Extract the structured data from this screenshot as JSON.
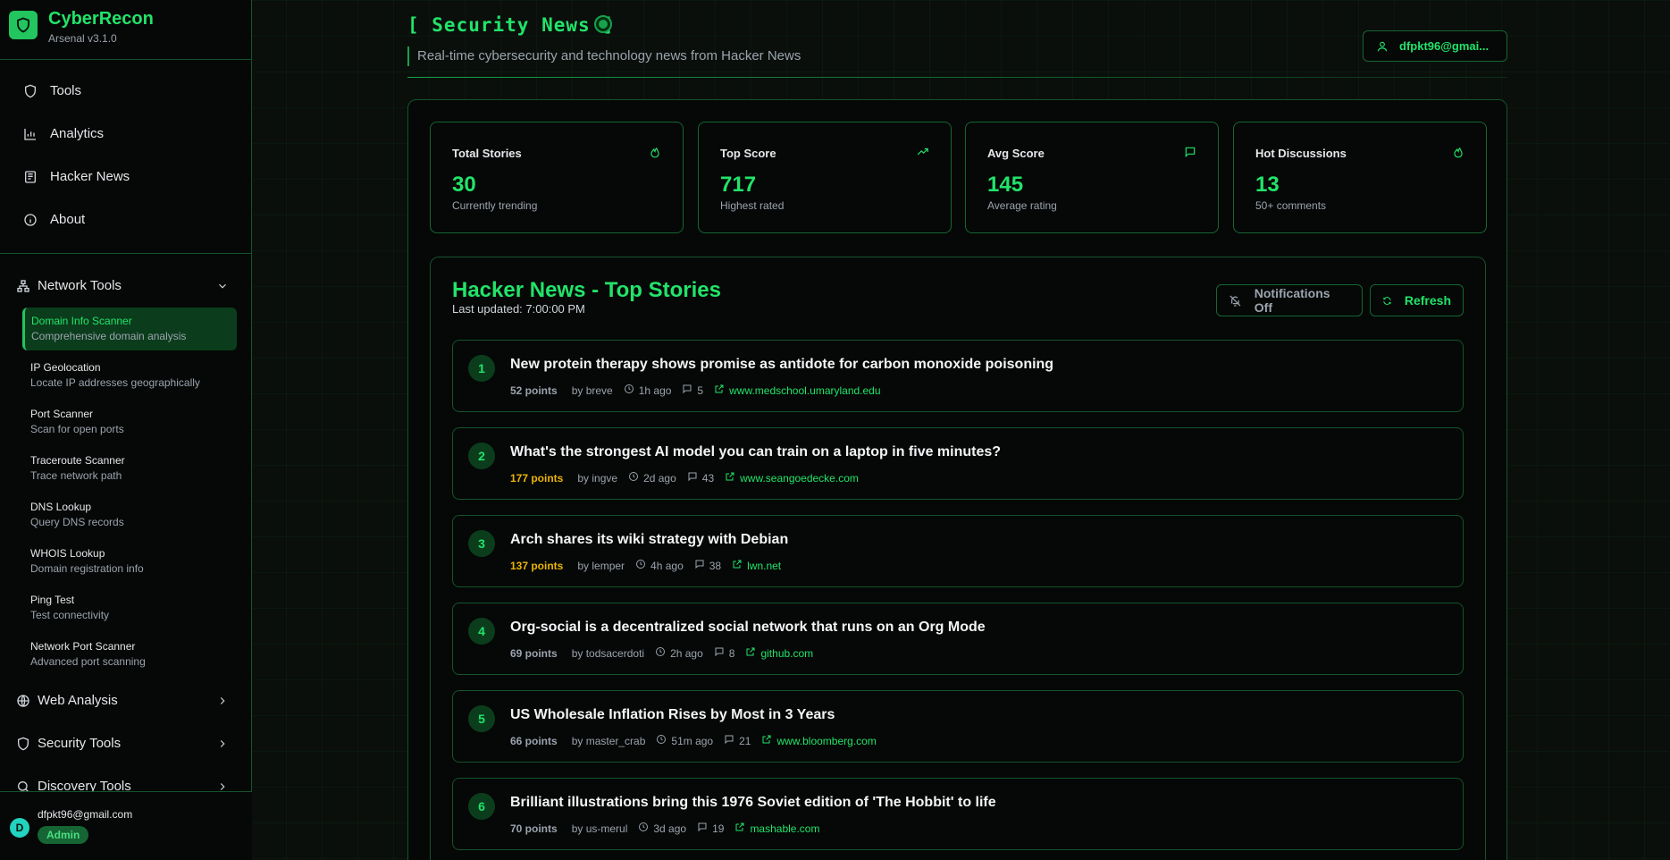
{
  "brand": {
    "title": "CyberRecon",
    "version": "Arsenal v3.1.0"
  },
  "nav": [
    {
      "label": "Tools",
      "icon": "shield-icon"
    },
    {
      "label": "Analytics",
      "icon": "bar-chart-icon"
    },
    {
      "label": "Hacker News",
      "icon": "newspaper-icon"
    },
    {
      "label": "About",
      "icon": "info-icon"
    }
  ],
  "groups": {
    "network": "Network Tools",
    "web": "Web Analysis",
    "security": "Security Tools",
    "discovery": "Discovery Tools"
  },
  "network_tools": [
    {
      "name": "Domain Info Scanner",
      "desc": "Comprehensive domain analysis"
    },
    {
      "name": "IP Geolocation",
      "desc": "Locate IP addresses geographically"
    },
    {
      "name": "Port Scanner",
      "desc": "Scan for open ports"
    },
    {
      "name": "Traceroute Scanner",
      "desc": "Trace network path"
    },
    {
      "name": "DNS Lookup",
      "desc": "Query DNS records"
    },
    {
      "name": "WHOIS Lookup",
      "desc": "Domain registration info"
    },
    {
      "name": "Ping Test",
      "desc": "Test connectivity"
    },
    {
      "name": "Network Port Scanner",
      "desc": "Advanced port scanning"
    }
  ],
  "user": {
    "initial": "D",
    "email": "dfpkt96@gmail.com",
    "role": "Admin",
    "short": "dfpkt96@gmai..."
  },
  "page": {
    "title": "[ Security News ]",
    "subtitle": "Real-time cybersecurity and technology news from Hacker News"
  },
  "stats": [
    {
      "label": "Total Stories",
      "value": "30",
      "note": "Currently trending",
      "icon": "flame-icon"
    },
    {
      "label": "Top Score",
      "value": "717",
      "note": "Highest rated",
      "icon": "trending-up-icon"
    },
    {
      "label": "Avg Score",
      "value": "145",
      "note": "Average rating",
      "icon": "message-icon"
    },
    {
      "label": "Hot Discussions",
      "value": "13",
      "note": "50+ comments",
      "icon": "flame-icon"
    }
  ],
  "stories_section": {
    "title": "Hacker News - Top Stories",
    "updated": "Last updated: 7:00:00 PM",
    "notif_label": "Notifications Off",
    "refresh_label": "Refresh"
  },
  "stories": [
    {
      "rank": "1",
      "title": "New protein therapy shows promise as antidote for carbon monoxide poisoning",
      "points": "52 points",
      "by": "by breve",
      "time": "1h ago",
      "comments": "5",
      "domain": "www.medschool.umaryland.edu"
    },
    {
      "rank": "2",
      "title": "What's the strongest AI model you can train on a laptop in five minutes?",
      "points": "177 points",
      "by": "by ingve",
      "time": "2d ago",
      "comments": "43",
      "domain": "www.seangoedecke.com"
    },
    {
      "rank": "3",
      "title": "Arch shares its wiki strategy with Debian",
      "points": "137 points",
      "by": "by lemper",
      "time": "4h ago",
      "comments": "38",
      "domain": "lwn.net"
    },
    {
      "rank": "4",
      "title": "Org-social is a decentralized social network that runs on an Org Mode",
      "points": "69 points",
      "by": "by todsacerdoti",
      "time": "2h ago",
      "comments": "8",
      "domain": "github.com"
    },
    {
      "rank": "5",
      "title": "US Wholesale Inflation Rises by Most in 3 Years",
      "points": "66 points",
      "by": "by master_crab",
      "time": "51m ago",
      "comments": "21",
      "domain": "www.bloomberg.com"
    },
    {
      "rank": "6",
      "title": "Brilliant illustrations bring this 1976 Soviet edition of 'The Hobbit' to life",
      "points": "70 points",
      "by": "by us-merul",
      "time": "3d ago",
      "comments": "19",
      "domain": "mashable.com"
    }
  ]
}
